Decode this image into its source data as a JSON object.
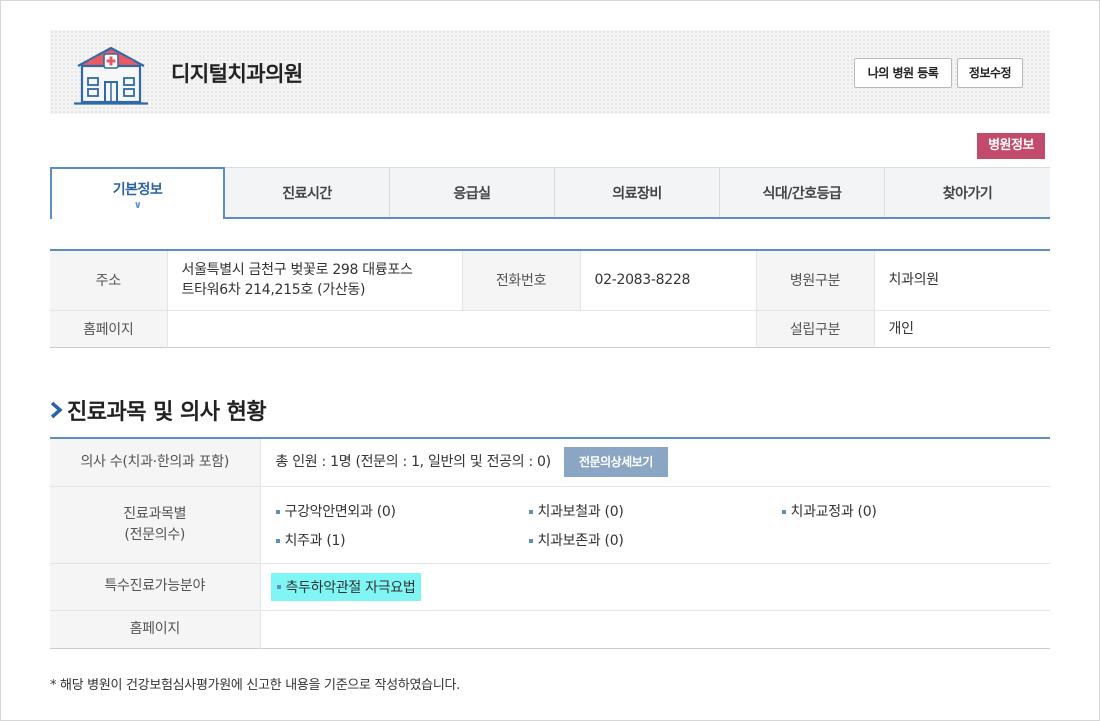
{
  "header": {
    "hospital_name": "디지털치과의원",
    "register_button": "나의 병원 등록",
    "edit_button": "정보수정"
  },
  "badge": "병원정보",
  "tabs": [
    {
      "label": "기본정보",
      "active": true
    },
    {
      "label": "진료시간"
    },
    {
      "label": "응급실"
    },
    {
      "label": "의료장비"
    },
    {
      "label": "식대/간호등급"
    },
    {
      "label": "찾아가기"
    }
  ],
  "basic_info": {
    "address_label": "주소",
    "address_line1": "서울특별시 금천구 벚꽃로 298 대륭포스",
    "address_line2": "트타워6차 214,215호 (가산동)",
    "phone_label": "전화번호",
    "phone": "02-2083-8228",
    "type_label": "병원구분",
    "type": "치과의원",
    "homepage_label": "홈페이지",
    "homepage": "",
    "founding_label": "설립구분",
    "founding": "개인"
  },
  "section_title": "진료과목 및 의사 현황",
  "doctors": {
    "count_label": "의사 수(치과·한의과 포함)",
    "count_text": "총 인원 : 1명 (전문의 : 1, 일반의 및 전공의 : 0)",
    "detail_button": "전문의상세보기",
    "dept_label_1": "진료과목별",
    "dept_label_2": "(전문의수)",
    "departments": [
      "구강악안면외과 (0)",
      "치과보철과 (0)",
      "치과교정과 (0)",
      "치주과 (1)",
      "치과보존과 (0)"
    ],
    "special_label": "특수진료가능분야",
    "special_item": "측두하악관절 자극요법",
    "homepage_label": "홈페이지",
    "homepage": ""
  },
  "footnote": "* 해당 병원이 건강보험심사평가원에 신고한 내용을 기준으로 작성하였습니다.",
  "icons": {
    "hospital": "hospital-building-icon",
    "section_marker": "chevron-right-icon",
    "tab_indicator": "chevron-down-icon"
  },
  "colors": {
    "accent_blue": "#5b8fc4",
    "badge": "#c24a6a",
    "highlight": "#7ff6f4",
    "detail_button": "#8aa6c4"
  }
}
